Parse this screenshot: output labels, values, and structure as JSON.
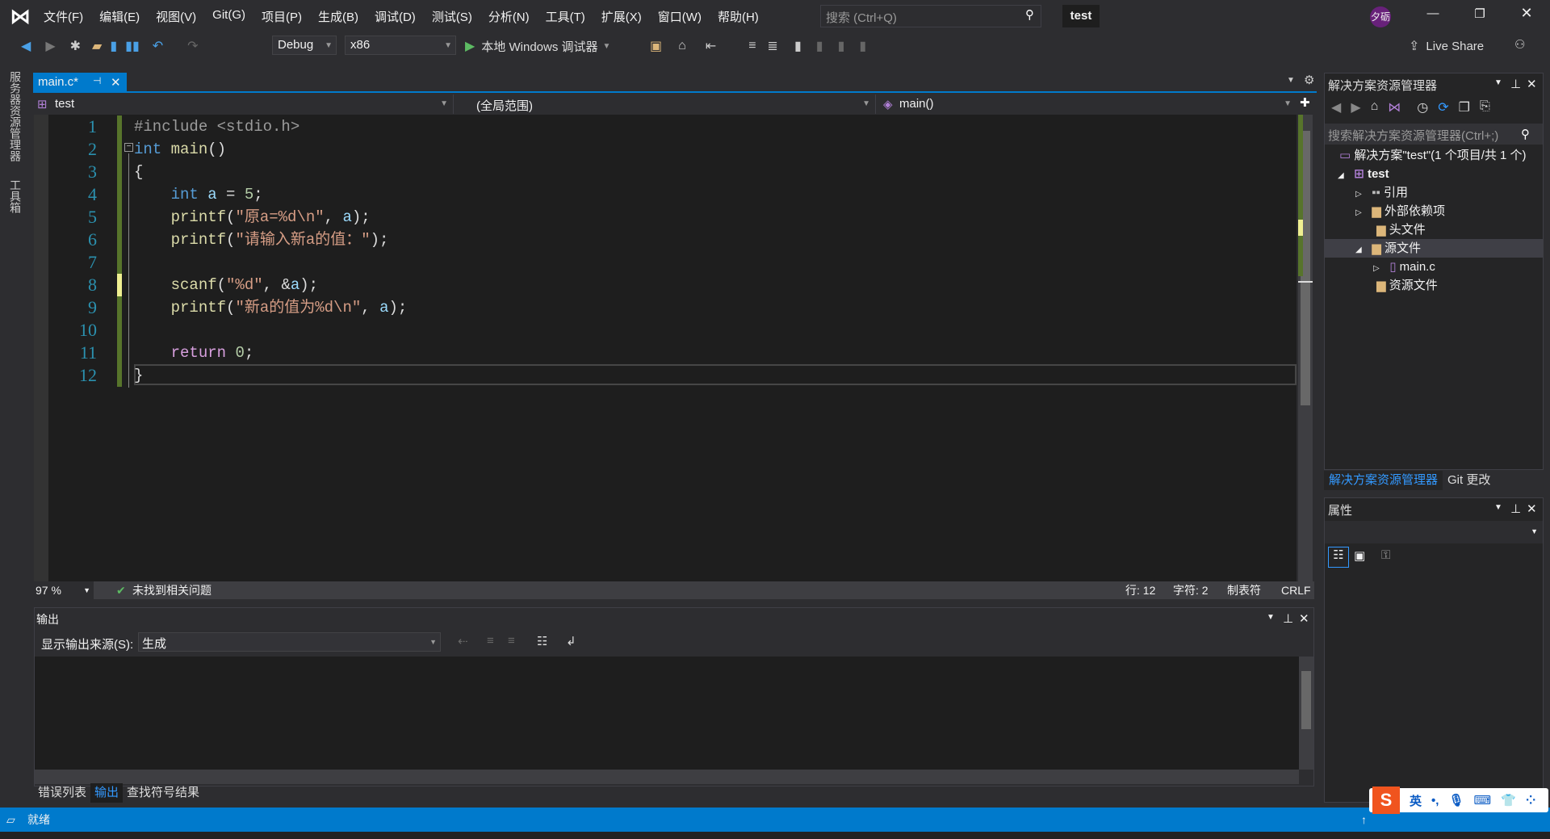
{
  "title_bar": {
    "menu": [
      "文件(F)",
      "编辑(E)",
      "视图(V)",
      "Git(G)",
      "项目(P)",
      "生成(B)",
      "调试(D)",
      "测试(S)",
      "分析(N)",
      "工具(T)",
      "扩展(X)",
      "窗口(W)",
      "帮助(H)"
    ],
    "search_placeholder": "搜索 (Ctrl+Q)",
    "solution_name": "test",
    "avatar": "夕砺",
    "accent": "#007acc"
  },
  "toolbar": {
    "config": "Debug",
    "platform": "x86",
    "run_label": "本地 Windows 调试器",
    "live_share": "Live Share"
  },
  "left_strip": [
    "服务器资源管理器",
    "工具箱"
  ],
  "editor": {
    "tab": "main.c*",
    "nav_project": "test",
    "nav_scope": "(全局范围)",
    "nav_member": "main()",
    "lines": [
      "1",
      "2",
      "3",
      "4",
      "5",
      "6",
      "7",
      "8",
      "9",
      "10",
      "11",
      "12"
    ],
    "zoom": "97 %",
    "issues": "未找到相关问题",
    "row": "行: 12",
    "col": "字符: 2",
    "tabs": "制表符",
    "eol": "CRLF"
  },
  "output": {
    "title": "输出",
    "source_label": "显示输出来源(S):",
    "source_value": "生成"
  },
  "bottom_tabs": [
    "错误列表",
    "输出",
    "查找符号结果"
  ],
  "status": {
    "text": "就绪"
  },
  "solution_explorer": {
    "title": "解决方案资源管理器",
    "search_placeholder": "搜索解决方案资源管理器(Ctrl+;)",
    "tree": [
      "解决方案\"test\"(1 个项目/共 1 个)",
      "test",
      "引用",
      "外部依赖项",
      "头文件",
      "源文件",
      "main.c",
      "资源文件"
    ],
    "tabs": [
      "解决方案资源管理器",
      "Git 更改"
    ]
  },
  "properties": {
    "title": "属性"
  },
  "ime": {
    "lang": "英"
  }
}
